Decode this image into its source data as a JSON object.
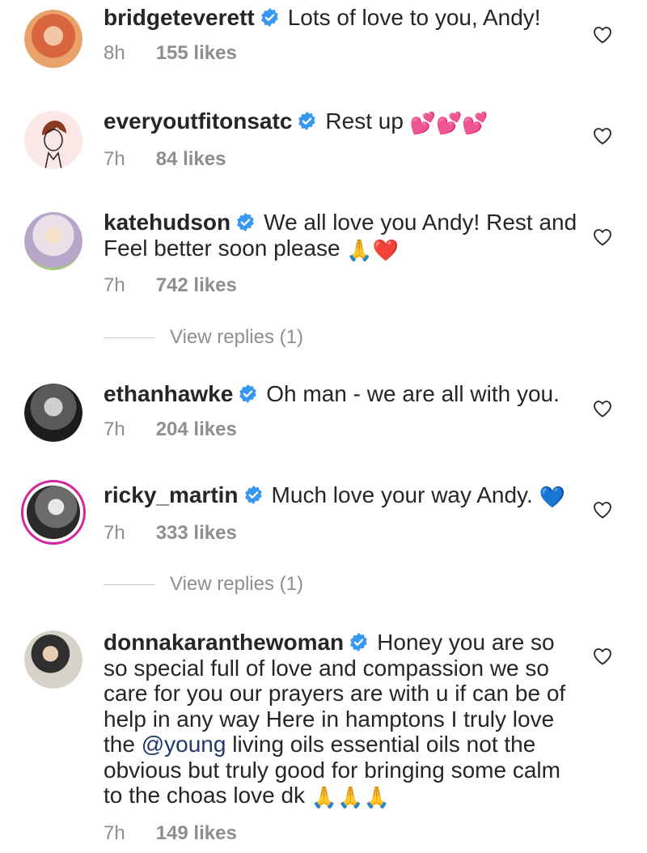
{
  "comments": [
    {
      "username": "bridgeteverett",
      "text": "Lots of love to you, Andy!",
      "time": "8h",
      "likes": "155 likes",
      "avatar_icon": "avatar-photo-icon"
    },
    {
      "username": "everyoutfitonsatc",
      "text": "Rest up",
      "emoji": "💕💕💕",
      "time": "7h",
      "likes": "84 likes",
      "avatar_icon": "avatar-sketch-icon"
    },
    {
      "username": "katehudson",
      "text": "We all love you Andy! Rest and Feel better soon please",
      "emoji": "🙏❤️",
      "time": "7h",
      "likes": "742 likes",
      "avatar_icon": "avatar-photo-icon"
    },
    {
      "username": "ethanhawke",
      "text": "Oh man - we are all with you.",
      "time": "7h",
      "likes": "204 likes",
      "avatar_icon": "avatar-photo-icon"
    },
    {
      "username": "ricky_martin",
      "text": "Much love your way Andy.",
      "emoji": "💙",
      "time": "7h",
      "likes": "333 likes",
      "avatar_icon": "avatar-story-ring-icon"
    },
    {
      "username": "donnakaranthewoman",
      "text_before_mention": "Honey you are so so special full of love and compassion we so care for you our prayers are with u if can be of help in any way  Here in hamptons I truly love the",
      "mention": "@young",
      "text_after_mention": "living oils essential oils not the obvious but truly good for bringing some calm to the choas love dk",
      "emoji": "🙏🙏🙏",
      "time": "7h",
      "likes": "149 likes",
      "avatar_icon": "avatar-photo-icon"
    }
  ],
  "view_replies": [
    "View replies (1)",
    "View replies (1)"
  ],
  "colors": {
    "text": "#262626",
    "secondary": "#8e8e8e",
    "verified": "#3897f0",
    "story_ring": "#d6249f",
    "mention": "#1f3a6b"
  }
}
